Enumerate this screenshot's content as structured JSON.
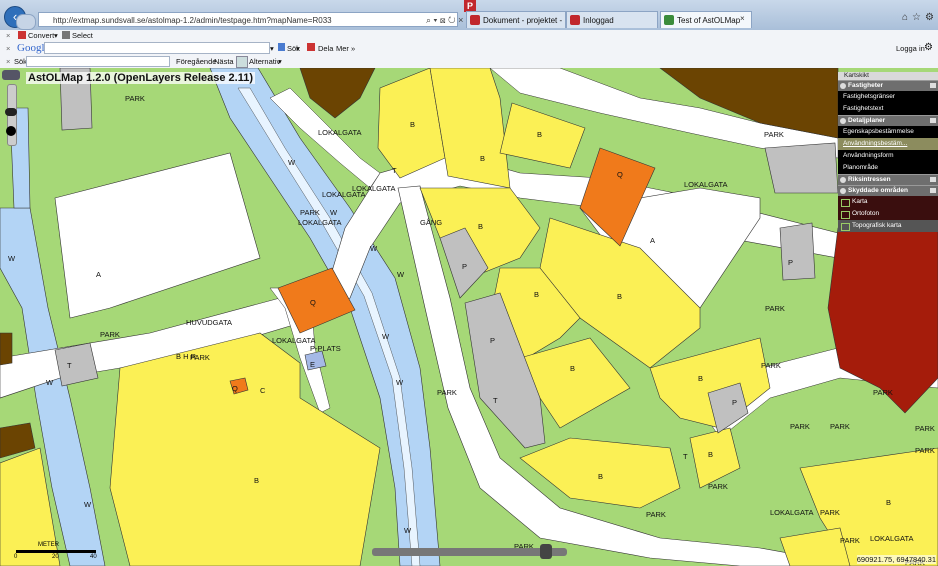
{
  "browser": {
    "url": "http://extmap.sundsvall.se/astolmap-1.2/admin/testpage.htm?mapName=R033",
    "tabs": [
      {
        "label": "Dokument - projektet - Project...",
        "active": false,
        "icon_color": "#c1272d"
      },
      {
        "label": "Inloggad",
        "active": false,
        "icon_color": "#c1272d"
      },
      {
        "label": "Test of AstOLMap",
        "active": true,
        "icon_color": "#3b8c3b"
      }
    ],
    "toolbar1": {
      "close": "×",
      "convert": "Convert",
      "select": "Select"
    },
    "toolbar2": {
      "close": "×",
      "google_logo": "Google",
      "search_btn": "Sök",
      "share_btn": "Dela",
      "more_btn": "Mer »",
      "login": "Logga in"
    },
    "toolbar3": {
      "close": "×",
      "find_label": "Sök:",
      "prev": "Föregående",
      "next": "Nästa",
      "options": "Alternativ"
    }
  },
  "map": {
    "title": "AstOLMap 1.2.0 (OpenLayers Release 2.11)",
    "coordinates": "690921.75, 6947840.31",
    "scale_label": "METER",
    "scale_ticks": [
      "0",
      "20",
      "40"
    ],
    "labels": {
      "park_1": "PARK",
      "park_2": "PARK",
      "park_3": "PARK",
      "park_4": "PARK",
      "park_5": "PARK",
      "park_6": "PARK",
      "park_7": "PARK",
      "park_8": "PARK",
      "park_9": "PARK",
      "park_10": "PARK",
      "park_11": "PARK",
      "park_12": "PARK",
      "park_13": "PARK",
      "park_14": "PARK",
      "park_15": "PARK",
      "park_16": "PARK",
      "park_17": "PARK",
      "park_18": "PARK",
      "park_19": "PARK",
      "lokalgata_1": "LOKALGATA",
      "lokalgata_2": "LOKALGATA",
      "lokalgata_3": "LOKALGATA",
      "lokalgata_4": "LOKALGATA",
      "lokalgata_5": "LOKALGATA",
      "lokalgata_6": "LOKALGATA",
      "lokalgata_7": "LOKALGATA",
      "lokalgata_8": "LOKALGATA",
      "huvudgata": "HUVUDGATA",
      "pplats": "P-PLATS",
      "bhr": "B H R",
      "gang": "GÅNG",
      "A1": "A",
      "A2": "A",
      "B1": "B",
      "B2": "B",
      "B3": "B",
      "B4": "B",
      "B5": "B",
      "B6": "B",
      "B7": "B",
      "B8": "B",
      "B9": "B",
      "B10": "B",
      "B11": "B",
      "B12": "B",
      "C1": "C",
      "Q1": "Q",
      "Q2": "Q",
      "Q3": "Q",
      "P1": "P",
      "P2": "P",
      "P3": "P",
      "P4": "P",
      "T1": "T",
      "T2": "T",
      "T3": "T",
      "T4": "T",
      "E1": "E",
      "W1": "W",
      "W2": "W",
      "W3": "W",
      "W4": "W",
      "W5": "W",
      "W6": "W",
      "W7": "W",
      "W8": "W",
      "W9": "W",
      "W10": "W"
    },
    "colors": {
      "park": "#a6d877",
      "housing": "#fbf055",
      "commerce": "#f07a1b",
      "parking": "#c0c0c0",
      "water": "#b3d4f5",
      "street": "#ffffff",
      "brown": "#6b4402",
      "red": "#a51c0b"
    }
  },
  "layers": {
    "top_label": "Kartskikt",
    "groups": [
      {
        "header": "Fastigheter",
        "items": [
          "Fastighetsgränser",
          "Fastighetstext"
        ]
      },
      {
        "header": "Detaljplaner",
        "items": [
          "Egenskapsbestämmelse",
          "Användningsbestäm...",
          "Användningsform",
          "Planområde"
        ]
      },
      {
        "header": "Riksintressen",
        "items": []
      },
      {
        "header": "Skyddade områden",
        "items": [
          "Karta",
          "Ortofoton",
          "Topografisk karta"
        ]
      }
    ]
  }
}
